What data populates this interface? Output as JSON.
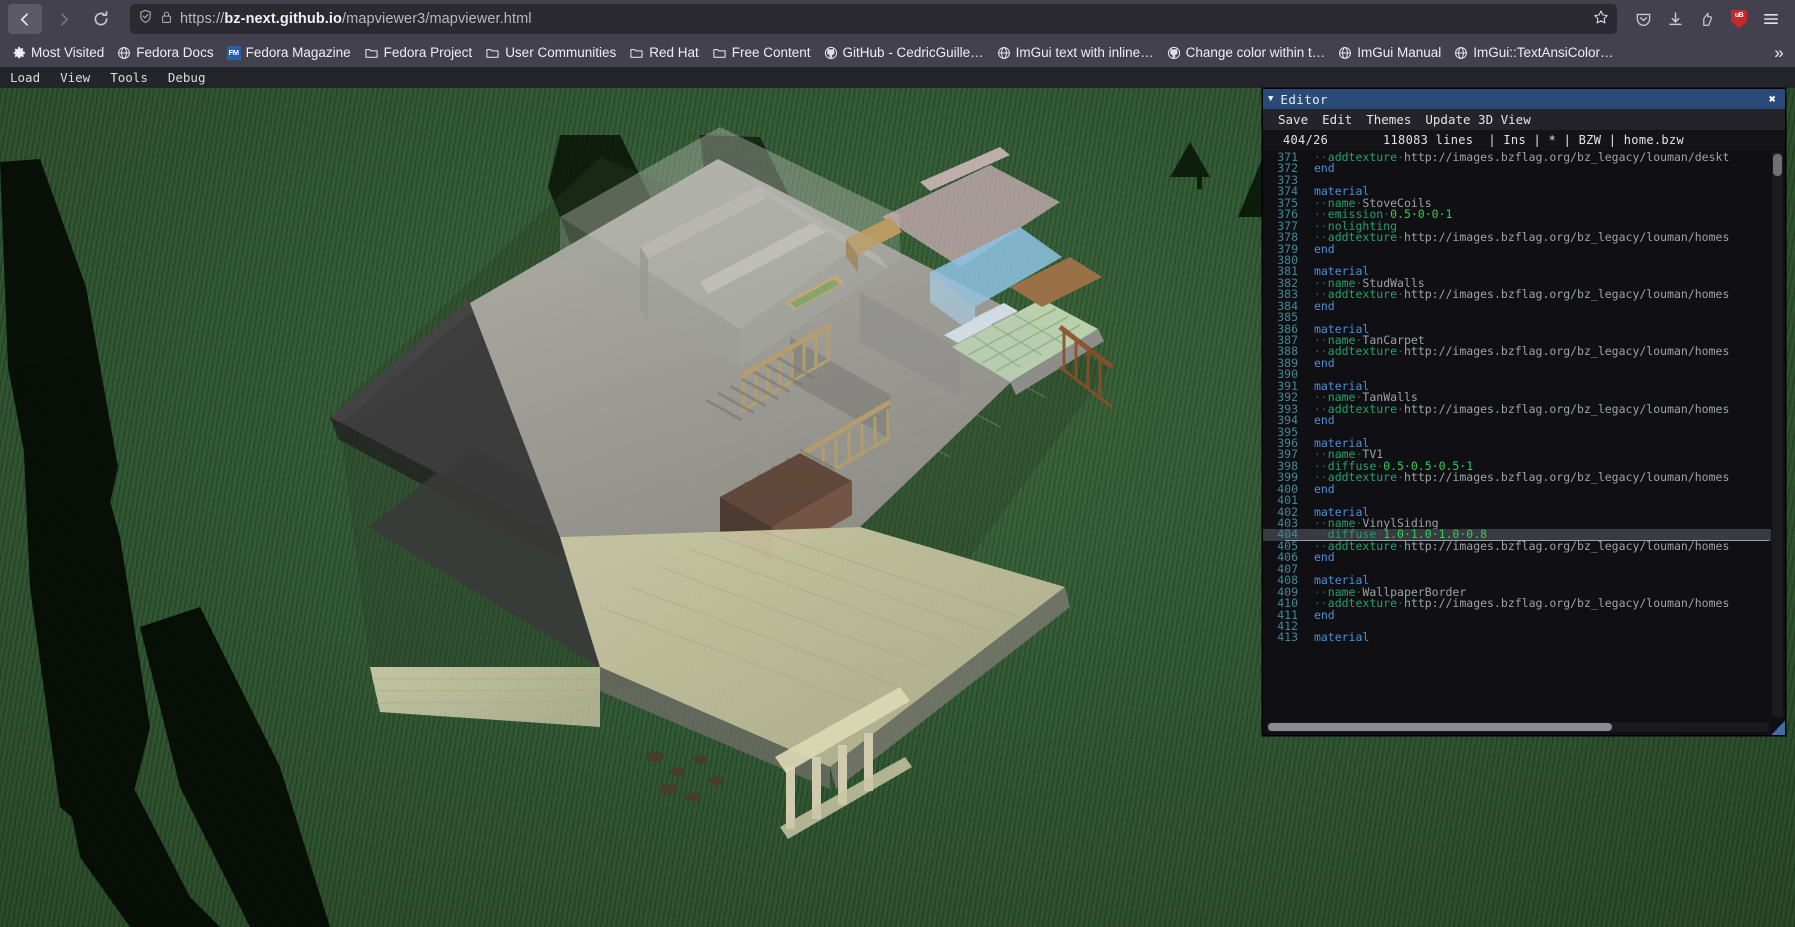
{
  "browser": {
    "back_icon": "arrow-left-icon",
    "forward_icon": "arrow-right-icon",
    "reload_icon": "reload-icon",
    "shield_icon": "shield-icon",
    "lock_icon": "lock-icon",
    "bookmark_star_icon": "star-icon",
    "url_scheme": "https://",
    "url_host": "bz-next.github.io",
    "url_path": "/mapviewer3/mapviewer.html",
    "toolbar_icons": [
      {
        "name": "pocket-icon",
        "glyph": "save-to-pocket"
      },
      {
        "name": "downloads-icon",
        "glyph": "download"
      },
      {
        "name": "account-icon",
        "glyph": "person"
      },
      {
        "name": "ublock-origin-icon",
        "glyph": "uB",
        "color": "#c02a2a"
      },
      {
        "name": "menu-icon",
        "glyph": "hamburger"
      }
    ]
  },
  "bookmarks": {
    "overflow_label": "»",
    "items": [
      {
        "label": "Most Visited",
        "icon": "gear-icon"
      },
      {
        "label": "Fedora Docs",
        "icon": "globe-icon"
      },
      {
        "label": "Fedora Magazine",
        "icon": "fedora-magazine-icon"
      },
      {
        "label": "Fedora Project",
        "icon": "folder-icon"
      },
      {
        "label": "User Communities",
        "icon": "folder-icon"
      },
      {
        "label": "Red Hat",
        "icon": "folder-icon"
      },
      {
        "label": "Free Content",
        "icon": "folder-icon"
      },
      {
        "label": "GitHub - CedricGuille…",
        "icon": "github-icon"
      },
      {
        "label": "ImGui text with inline…",
        "icon": "globe-icon"
      },
      {
        "label": "Change color within t…",
        "icon": "github-icon"
      },
      {
        "label": "ImGui Manual",
        "icon": "globe-icon"
      },
      {
        "label": "ImGui::TextAnsiColor…",
        "icon": "globe-icon"
      }
    ]
  },
  "app_menu": {
    "items": [
      "Load",
      "View",
      "Tools",
      "Debug"
    ]
  },
  "viewport": {
    "ground_color": "#2d5530",
    "description": "3D isometric cutaway view of a two-story house on a green ground plane with dark tree shadows"
  },
  "editor": {
    "title": "Editor",
    "collapse_icon": "triangle-down-icon",
    "close_icon": "close-icon",
    "menu": [
      "Save",
      "Edit",
      "Themes",
      "Update 3D View"
    ],
    "status": {
      "cursor": "404/26",
      "lines": "118083 lines",
      "mode": "Ins",
      "modified": "*",
      "syntax": "BZW",
      "filename": "home.bzw",
      "full": "118083 lines  | Ins | * | BZW | home.bzw"
    },
    "highlighted_line": 404,
    "first_visible_line": 371,
    "lines": [
      {
        "n": 371,
        "indent": 2,
        "attr": "addtexture",
        "val": "http://images.bzflag.org/bz_legacy/louman/deskt",
        "kind": "attr"
      },
      {
        "n": 372,
        "indent": 0,
        "kw": "end",
        "kind": "kw"
      },
      {
        "n": 373,
        "kind": "blank"
      },
      {
        "n": 374,
        "indent": 0,
        "kw": "material",
        "kind": "kw"
      },
      {
        "n": 375,
        "indent": 2,
        "attr": "name",
        "val": "StoveCoils",
        "kind": "attr"
      },
      {
        "n": 376,
        "indent": 2,
        "attr": "emission",
        "num": "0.5 0 0 1",
        "kind": "num"
      },
      {
        "n": 377,
        "indent": 2,
        "attr": "nolighting",
        "kind": "attr-only"
      },
      {
        "n": 378,
        "indent": 2,
        "attr": "addtexture",
        "val": "http://images.bzflag.org/bz_legacy/louman/homes",
        "kind": "attr"
      },
      {
        "n": 379,
        "indent": 0,
        "kw": "end",
        "kind": "kw"
      },
      {
        "n": 380,
        "kind": "blank"
      },
      {
        "n": 381,
        "indent": 0,
        "kw": "material",
        "kind": "kw"
      },
      {
        "n": 382,
        "indent": 2,
        "attr": "name",
        "val": "StudWalls",
        "kind": "attr"
      },
      {
        "n": 383,
        "indent": 2,
        "attr": "addtexture",
        "val": "http://images.bzflag.org/bz_legacy/louman/homes",
        "kind": "attr"
      },
      {
        "n": 384,
        "indent": 0,
        "kw": "end",
        "kind": "kw"
      },
      {
        "n": 385,
        "kind": "blank"
      },
      {
        "n": 386,
        "indent": 0,
        "kw": "material",
        "kind": "kw"
      },
      {
        "n": 387,
        "indent": 2,
        "attr": "name",
        "val": "TanCarpet",
        "kind": "attr"
      },
      {
        "n": 388,
        "indent": 2,
        "attr": "addtexture",
        "val": "http://images.bzflag.org/bz_legacy/louman/homes",
        "kind": "attr"
      },
      {
        "n": 389,
        "indent": 0,
        "kw": "end",
        "kind": "kw"
      },
      {
        "n": 390,
        "kind": "blank"
      },
      {
        "n": 391,
        "indent": 0,
        "kw": "material",
        "kind": "kw"
      },
      {
        "n": 392,
        "indent": 2,
        "attr": "name",
        "val": "TanWalls",
        "kind": "attr"
      },
      {
        "n": 393,
        "indent": 2,
        "attr": "addtexture",
        "val": "http://images.bzflag.org/bz_legacy/louman/homes",
        "kind": "attr"
      },
      {
        "n": 394,
        "indent": 0,
        "kw": "end",
        "kind": "kw"
      },
      {
        "n": 395,
        "kind": "blank"
      },
      {
        "n": 396,
        "indent": 0,
        "kw": "material",
        "kind": "kw"
      },
      {
        "n": 397,
        "indent": 2,
        "attr": "name",
        "val": "TV1",
        "kind": "attr"
      },
      {
        "n": 398,
        "indent": 2,
        "attr": "diffuse",
        "num": "0.5 0.5 0.5 1",
        "kind": "num"
      },
      {
        "n": 399,
        "indent": 2,
        "attr": "addtexture",
        "val": "http://images.bzflag.org/bz_legacy/louman/homes",
        "kind": "attr"
      },
      {
        "n": 400,
        "indent": 0,
        "kw": "end",
        "kind": "kw"
      },
      {
        "n": 401,
        "kind": "blank"
      },
      {
        "n": 402,
        "indent": 0,
        "kw": "material",
        "kind": "kw"
      },
      {
        "n": 403,
        "indent": 2,
        "attr": "name",
        "val": "VinylSiding",
        "kind": "attr"
      },
      {
        "n": 404,
        "indent": 2,
        "attr": "diffuse",
        "num": "1.0 1.0 1.0 0.8",
        "kind": "num",
        "highlight": true
      },
      {
        "n": 405,
        "indent": 2,
        "attr": "addtexture",
        "val": "http://images.bzflag.org/bz_legacy/louman/homes",
        "kind": "attr"
      },
      {
        "n": 406,
        "indent": 0,
        "kw": "end",
        "kind": "kw"
      },
      {
        "n": 407,
        "kind": "blank"
      },
      {
        "n": 408,
        "indent": 0,
        "kw": "material",
        "kind": "kw"
      },
      {
        "n": 409,
        "indent": 2,
        "attr": "name",
        "val": "WallpaperBorder",
        "kind": "attr"
      },
      {
        "n": 410,
        "indent": 2,
        "attr": "addtexture",
        "val": "http://images.bzflag.org/bz_legacy/louman/homes",
        "kind": "attr"
      },
      {
        "n": 411,
        "indent": 0,
        "kw": "end",
        "kind": "kw"
      },
      {
        "n": 412,
        "kind": "blank"
      },
      {
        "n": 413,
        "indent": 0,
        "kw": "material",
        "kind": "kw"
      }
    ]
  },
  "colors": {
    "title_bar": "#2a4a77",
    "keyword": "#4a8fd6",
    "attribute": "#1fa36a",
    "number": "#31d04f",
    "line_number": "#3f8a96",
    "value": "#9aa4a8",
    "editor_bg": "#101014"
  }
}
